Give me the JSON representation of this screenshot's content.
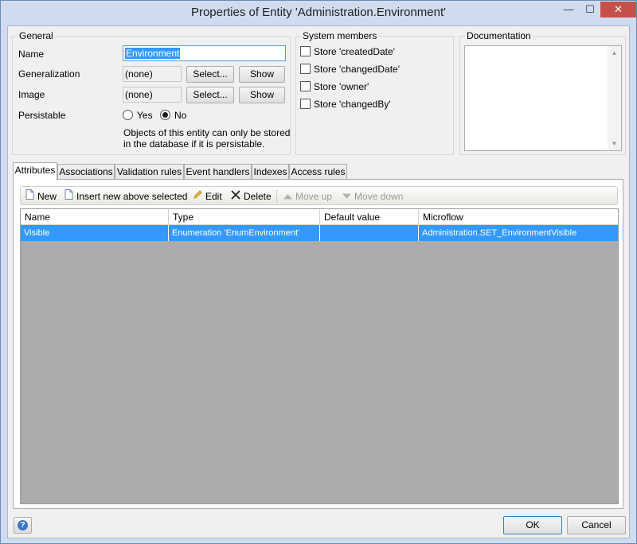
{
  "window": {
    "title": "Properties of Entity 'Administration.Environment'",
    "controls": {
      "minimize": "—",
      "maximize": "☐",
      "close": "✕"
    }
  },
  "general": {
    "title": "General",
    "name_label": "Name",
    "name_value": "Environment",
    "generalization_label": "Generalization",
    "generalization_value": "(none)",
    "image_label": "Image",
    "image_value": "(none)",
    "select_label": "Select...",
    "show_label": "Show",
    "persistable_label": "Persistable",
    "persistable_options": [
      {
        "label": "Yes",
        "selected": false
      },
      {
        "label": "No",
        "selected": true
      }
    ],
    "note_line1": "Objects of this entity can only be stored",
    "note_line2": "in the database if it is persistable."
  },
  "system_members": {
    "title": "System members",
    "items": [
      {
        "label": "Store 'createdDate'",
        "checked": false
      },
      {
        "label": "Store 'changedDate'",
        "checked": false
      },
      {
        "label": "Store 'owner'",
        "checked": false
      },
      {
        "label": "Store 'changedBy'",
        "checked": false
      }
    ]
  },
  "documentation": {
    "title": "Documentation",
    "value": ""
  },
  "tabs": [
    {
      "label": "Attributes",
      "active": true
    },
    {
      "label": "Associations",
      "active": false
    },
    {
      "label": "Validation rules",
      "active": false
    },
    {
      "label": "Event handlers",
      "active": false
    },
    {
      "label": "Indexes",
      "active": false
    },
    {
      "label": "Access rules",
      "active": false
    }
  ],
  "toolbar": {
    "new": "New",
    "insert_above": "Insert new above selected",
    "edit": "Edit",
    "delete": "Delete",
    "move_up": "Move up",
    "move_down": "Move down"
  },
  "table": {
    "columns": [
      "Name",
      "Type",
      "Default value",
      "Microflow"
    ],
    "rows": [
      [
        "Visible",
        "Enumeration 'EnumEnvironment'",
        "",
        "Administration.SET_EnvironmentVisible"
      ]
    ]
  },
  "footer": {
    "help_icon": "?",
    "ok": "OK",
    "cancel": "Cancel"
  },
  "colors": {
    "selection": "#3399ff",
    "close_button": "#c7504a",
    "grid_background": "#ababab"
  }
}
